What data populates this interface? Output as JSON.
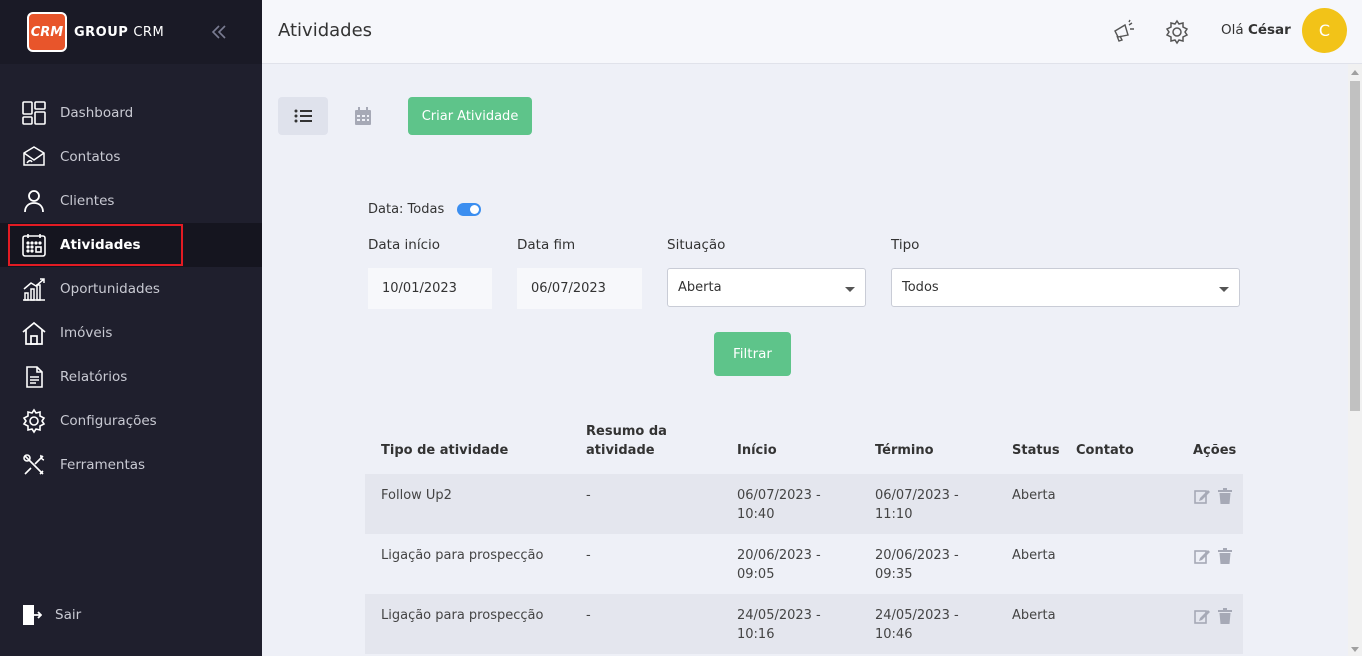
{
  "brand": {
    "logo_text": "CRM",
    "name_bold": "GROUP",
    "name_rest": "CRM"
  },
  "sidebar": {
    "items": [
      {
        "label": "Dashboard",
        "icon": "dashboard-icon"
      },
      {
        "label": "Contatos",
        "icon": "contacts-icon"
      },
      {
        "label": "Clientes",
        "icon": "user-icon"
      },
      {
        "label": "Atividades",
        "icon": "calendar-icon",
        "active": true
      },
      {
        "label": "Oportunidades",
        "icon": "chart-icon"
      },
      {
        "label": "Imóveis",
        "icon": "home-icon"
      },
      {
        "label": "Relatórios",
        "icon": "document-icon"
      },
      {
        "label": "Configurações",
        "icon": "gear-icon"
      },
      {
        "label": "Ferramentas",
        "icon": "tools-icon"
      }
    ],
    "logout": "Sair"
  },
  "header": {
    "title": "Atividades",
    "greeting": "Olá",
    "user_name": "César",
    "avatar_initial": "C"
  },
  "toolbar": {
    "create_label": "Criar Atividade"
  },
  "filters": {
    "date_toggle_label": "Data: Todas",
    "date_start_label": "Data início",
    "date_start_value": "10/01/2023",
    "date_end_label": "Data fim",
    "date_end_value": "06/07/2023",
    "situation_label": "Situação",
    "situation_value": "Aberta",
    "type_label": "Tipo",
    "type_value": "Todos",
    "filter_button": "Filtrar"
  },
  "table": {
    "headers": [
      "Tipo de atividade",
      "Resumo da atividade",
      "Início",
      "Término",
      "Status",
      "Contato",
      "Ações"
    ],
    "rows": [
      {
        "type": "Follow Up2",
        "summary": "-",
        "start": "06/07/2023 - 10:40",
        "end": "06/07/2023 - 11:10",
        "status": "Aberta",
        "contact": ""
      },
      {
        "type": "Ligação para prospecção",
        "summary": "-",
        "start": "20/06/2023 - 09:05",
        "end": "20/06/2023 - 09:35",
        "status": "Aberta",
        "contact": ""
      },
      {
        "type": "Ligação para prospecção",
        "summary": "-",
        "start": "24/05/2023 - 10:16",
        "end": "24/05/2023 - 10:46",
        "status": "Aberta",
        "contact": ""
      }
    ]
  },
  "colors": {
    "accent_green": "#5ec48a",
    "sidebar_bg": "#1f1f2d",
    "avatar": "#f2c318",
    "highlight_red": "#e21b23",
    "toggle_blue": "#3b8ef0"
  }
}
